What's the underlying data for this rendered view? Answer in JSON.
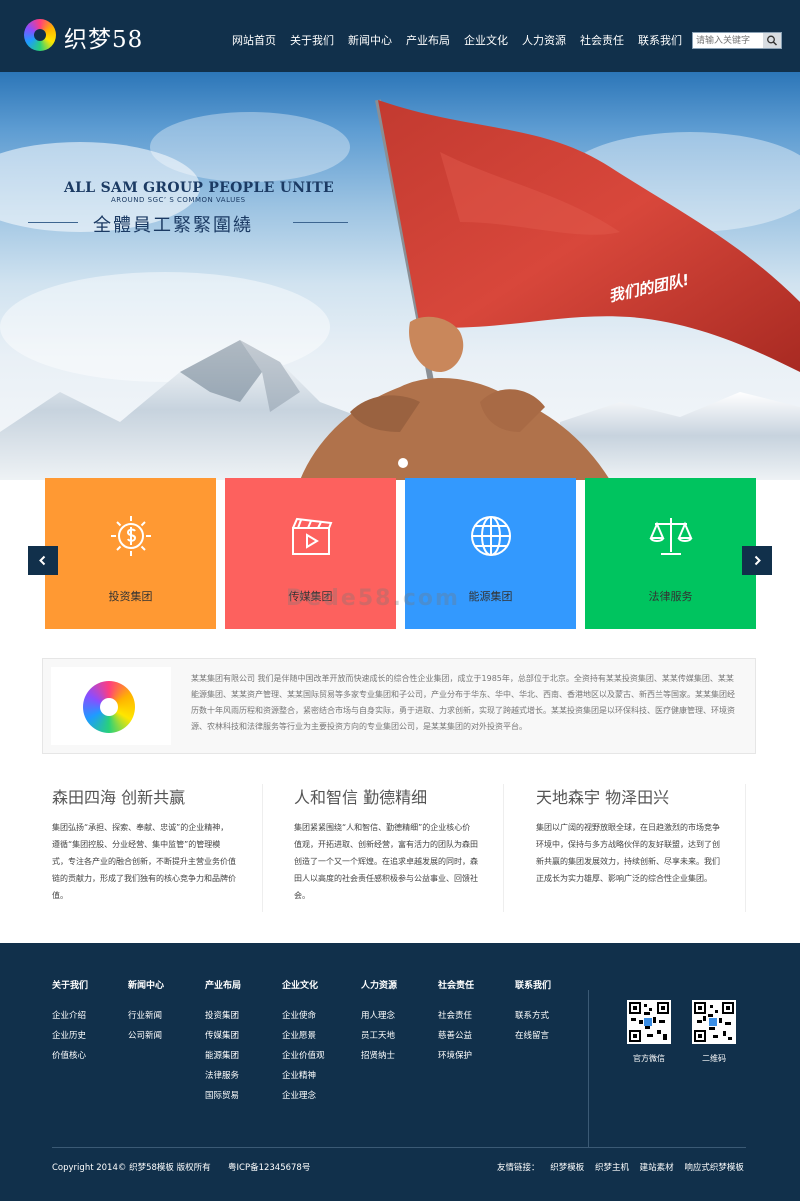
{
  "header": {
    "logo_text": "织梦58",
    "nav": [
      "网站首页",
      "关于我们",
      "新闻中心",
      "产业布局",
      "企业文化",
      "人力资源",
      "社会责任",
      "联系我们"
    ],
    "search_placeholder": "请输入关键字"
  },
  "banner": {
    "en_title": "ALL SAM GROUP PEOPLE UNITE",
    "en_sub": "AROUND SGC’ S COMMON VALUES",
    "cn_title": "全體員工緊緊圍繞",
    "flag_text": "我们的团队!"
  },
  "cards": [
    {
      "label": "投资集团",
      "color": "#ff9933",
      "icon": "money-bulb-icon"
    },
    {
      "label": "传媒集团",
      "color": "#fd615e",
      "icon": "film-clapper-icon"
    },
    {
      "label": "能源集团",
      "color": "#3399fe",
      "icon": "globe-icon"
    },
    {
      "label": "法律服务",
      "color": "#00c45f",
      "icon": "scales-icon"
    }
  ],
  "watermark": "Dede58.com",
  "about": {
    "text": "某某集团有限公司 我们是伴随中国改革开放而快速成长的综合性企业集团，成立于1985年，总部位于北京。全资持有某某投资集团、某某传媒集团、某某能源集团、某某资产管理、某某国际贸易等多家专业集团和子公司，产业分布于华东、华中、华北、西南、香港地区以及蒙古、新西兰等国家。某某集团经历数十年风雨历程和资源整合，紧密结合市场与自身实际，勇于进取、力求创新，实现了跨越式增长。某某投资集团是以环保科技、医疗健康管理、环境资源、农林科技和法律服务等行业为主要投资方向的专业集团公司，是某某集团的对外投资平台。"
  },
  "columns": [
    {
      "title": "森田四海  创新共赢",
      "text": "集团弘扬“承担、探索、奉献、忠诚”的企业精神，遵循“集团控股、分业经营、集中监管”的管理模式，专注各产业的融合创新，不断提升主营业务价值链的贡献力，形成了我们独有的核心竞争力和品牌价值。"
    },
    {
      "title": "人和智信   勤德精细",
      "text": "集团紧紧围绕“人和智信、勤德精细”的企业核心价值观，开拓进取、创新经营，富有活力的团队为森田创造了一个又一个辉煌。在追求卓越发展的同时，森田人以高度的社会责任感积极参与公益事业、回馈社会。"
    },
    {
      "title": "天地森宇  物泽田兴",
      "text": "集团以广阔的视野放眼全球，在日趋激烈的市场竞争环境中，保持与多方战略伙伴的友好联盟，达到了创新共赢的集团发展效力，持续创新、尽享未来。我们正成长为实力雄厚、影响广泛的综合性企业集团。"
    }
  ],
  "footer": {
    "columns": [
      {
        "title": "关于我们",
        "links": [
          "企业介绍",
          "企业历史",
          "价值核心"
        ]
      },
      {
        "title": "新闻中心",
        "links": [
          "行业新闻",
          "公司新闻"
        ]
      },
      {
        "title": "产业布局",
        "links": [
          "投资集团",
          "传媒集团",
          "能源集团",
          "法律服务",
          "国际贸易"
        ]
      },
      {
        "title": "企业文化",
        "links": [
          "企业使命",
          "企业愿景",
          "企业价值观",
          "企业精神",
          "企业理念"
        ]
      },
      {
        "title": "人力资源",
        "links": [
          "用人理念",
          "员工天地",
          "招贤纳士"
        ]
      },
      {
        "title": "社会责任",
        "links": [
          "社会责任",
          "慈善公益",
          "环境保护"
        ]
      },
      {
        "title": "联系我们",
        "links": [
          "联系方式",
          "在线留言"
        ]
      }
    ],
    "qr": [
      {
        "label": "官方微信"
      },
      {
        "label": "二维码"
      }
    ],
    "copyright": "Copyright 2014© 织梦58模板 版权所有",
    "icp": "粤ICP备12345678号",
    "friend_label": "友情链接：",
    "friend_links": [
      "织梦模板",
      "织梦主机",
      "建站素材",
      "响应式织梦模板"
    ]
  }
}
